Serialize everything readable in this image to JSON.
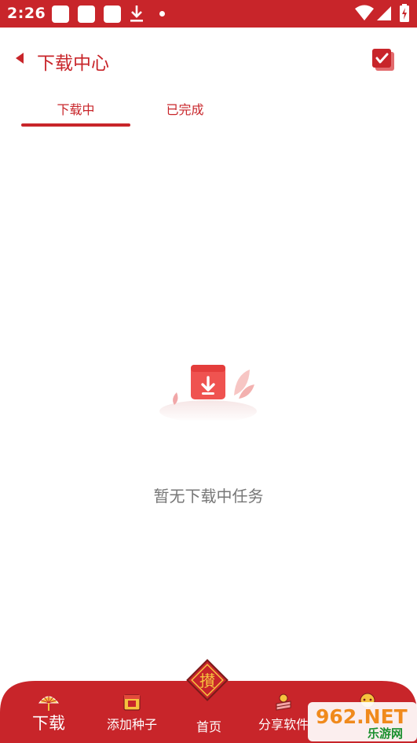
{
  "status_bar": {
    "time": "2:26",
    "icons": [
      "notification-square-icon",
      "notification-square-icon",
      "notification-square-icon",
      "download-icon",
      "dot-icon",
      "wifi-icon",
      "signal-icon",
      "battery-icon"
    ]
  },
  "header": {
    "title": "下载中心",
    "back_icon": "back-arrow-icon",
    "action_icon": "select-all-checkbox-icon"
  },
  "tabs": [
    {
      "label": "下载中",
      "active": true
    },
    {
      "label": "已完成",
      "active": false
    }
  ],
  "empty_state": {
    "icon": "download-box-icon",
    "message": "暂无下载中任务"
  },
  "bottom_nav": {
    "items": [
      {
        "label": "下载",
        "icon": "fan-icon",
        "active": true
      },
      {
        "label": "添加种子",
        "icon": "gift-box-icon",
        "active": false
      },
      {
        "label": "首页",
        "icon": "diamond-emblem-icon",
        "active": false
      },
      {
        "label": "分享软件",
        "icon": "share-lantern-icon",
        "active": false
      },
      {
        "label": "",
        "icon": "tiger-icon",
        "active": false
      }
    ],
    "center_emblem_text": "攅"
  },
  "watermark": {
    "brand": "962.NET",
    "sub": "乐游网"
  },
  "colors": {
    "primary": "#c8252a",
    "empty_text": "#777777",
    "nav_bg": "#c8252a"
  }
}
